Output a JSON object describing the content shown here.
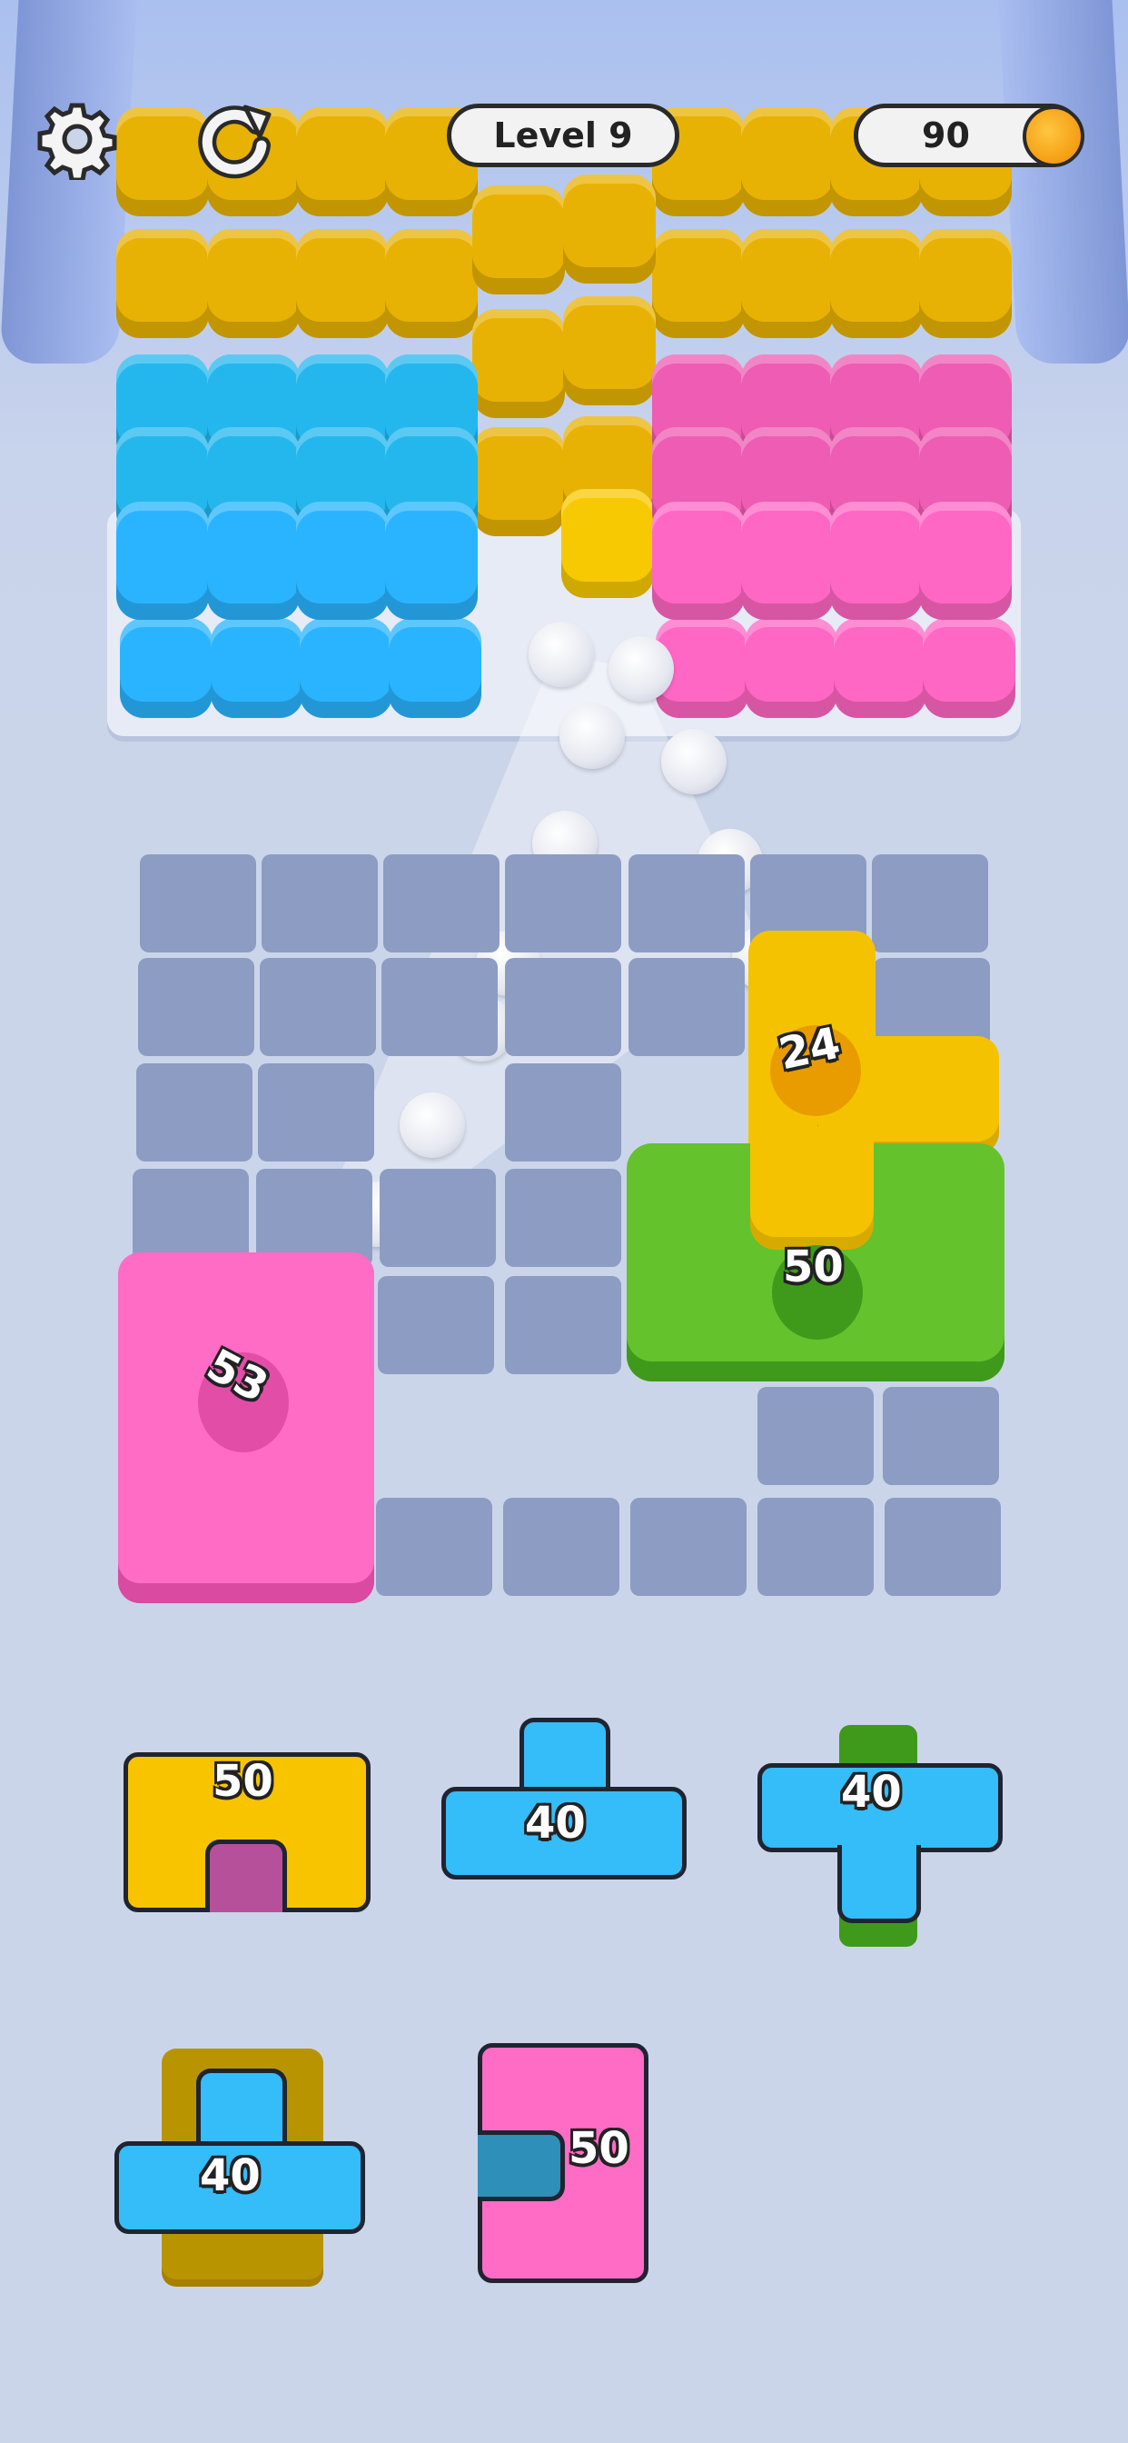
{
  "hud": {
    "level_label": "Level 9",
    "coins": "90",
    "settings_icon": "gear-icon",
    "restart_icon": "restart-icon",
    "coin_icon": "coin-icon"
  },
  "board": {
    "pieces": [
      {
        "color": "pink",
        "count": "53"
      },
      {
        "color": "yellow",
        "count": "24"
      },
      {
        "color": "green",
        "count": "50"
      }
    ]
  },
  "tray": {
    "pieces": [
      {
        "color": "yellow",
        "count": "50"
      },
      {
        "color": "blue",
        "count": "40"
      },
      {
        "color": "blue",
        "count": "40"
      },
      {
        "color": "blue",
        "count": "40"
      },
      {
        "color": "pink",
        "count": "50"
      }
    ]
  },
  "colors": {
    "yellow": "#f7c903",
    "blue": "#2ab4ff",
    "pink": "#ff67c4",
    "green": "#6cc933",
    "background": "#cbd5ea"
  }
}
